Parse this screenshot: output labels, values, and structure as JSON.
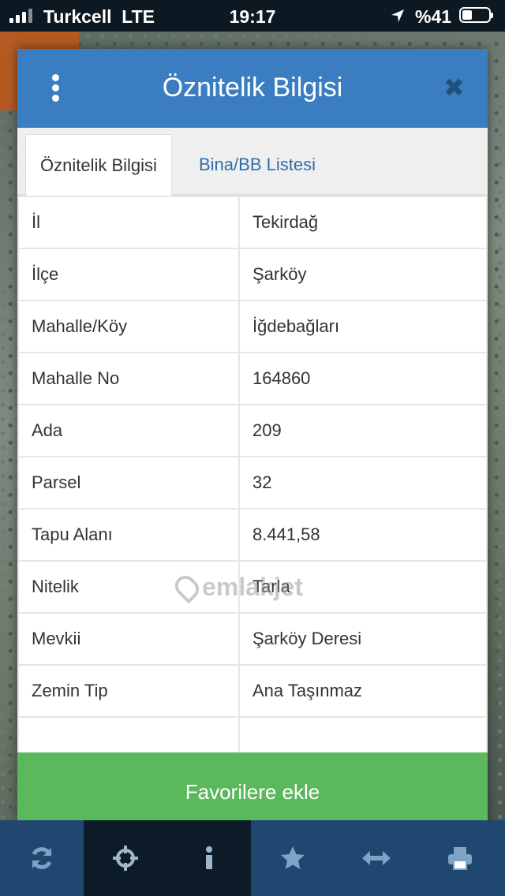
{
  "status": {
    "carrier": "Turkcell",
    "network": "LTE",
    "time": "19:17",
    "battery": "%41"
  },
  "modal": {
    "title": "Öznitelik Bilgisi",
    "tabs": [
      {
        "label": "Öznitelik Bilgisi",
        "active": true
      },
      {
        "label": "Bina/BB Listesi",
        "active": false
      }
    ],
    "rows": [
      {
        "key": "İl",
        "value": "Tekirdağ"
      },
      {
        "key": "İlçe",
        "value": "Şarköy"
      },
      {
        "key": "Mahalle/Köy",
        "value": "İğdebağları"
      },
      {
        "key": "Mahalle No",
        "value": "164860"
      },
      {
        "key": "Ada",
        "value": "209"
      },
      {
        "key": "Parsel",
        "value": "32"
      },
      {
        "key": "Tapu Alanı",
        "value": "8.441,58"
      },
      {
        "key": "Nitelik",
        "value": "Tarla"
      },
      {
        "key": "Mevkii",
        "value": "Şarköy Deresi"
      },
      {
        "key": "Zemin Tip",
        "value": "Ana Taşınmaz"
      }
    ],
    "favorite_label": "Favorilere ekle",
    "watermark": "emlakjet"
  },
  "colors": {
    "header": "#3a7dc0",
    "favorite": "#5cb85c",
    "toolbar": "#1f4770"
  },
  "toolbar_icons": [
    "refresh-icon",
    "crosshair-icon",
    "info-icon",
    "star-icon",
    "measure-icon",
    "print-icon"
  ]
}
